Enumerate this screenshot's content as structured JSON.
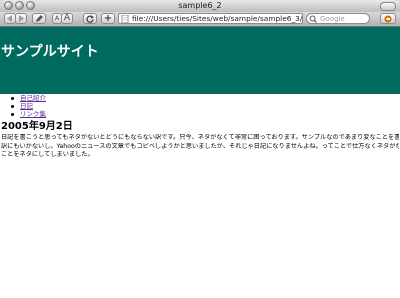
{
  "window": {
    "title": "sample6_2"
  },
  "toolbar": {
    "text_small_label": "A",
    "text_large_label": "A",
    "url": "file:///Users/ties/Sites/web/sample/sample6_3/sample",
    "search_placeholder": "Google"
  },
  "page": {
    "site_title": "サンプルサイト",
    "nav": [
      {
        "label": "自己紹介"
      },
      {
        "label": "日記"
      },
      {
        "label": "リンク集"
      }
    ],
    "post": {
      "date": "2005年9月2日",
      "lines": [
        "日記を書こうと思ってもネタがないとどうにもならない訳です。只今、ネタがなくて非常に困っております。サンプルなのであまり変なことを書く",
        "訳にもいかないし。Yahooのニュースの文章でもコピペしようかと思いましたが、それじゃ日記になりませんよね。ってことで仕方なくネタがない",
        "ことをネタにしてしまいました。"
      ]
    }
  },
  "colors": {
    "header_bg": "#006a5e",
    "link": "#5a2b97"
  }
}
